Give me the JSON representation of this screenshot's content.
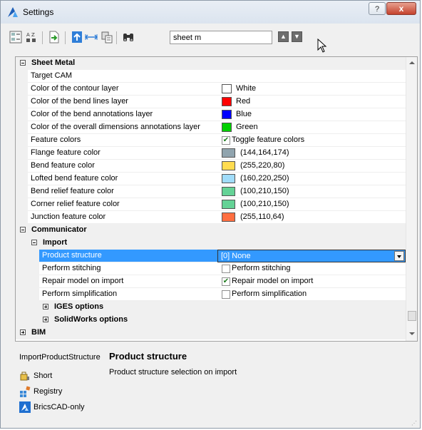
{
  "window": {
    "title": "Settings",
    "help_label": "?",
    "close_label": "x"
  },
  "toolbar": {
    "search_value": "sheet m",
    "search_placeholder": ""
  },
  "grid": {
    "sheet_metal": {
      "label": "Sheet Metal",
      "rows": [
        {
          "name": "Target CAM",
          "value": ""
        },
        {
          "name": "Color of the contour layer",
          "value": "White",
          "color": "#ffffff"
        },
        {
          "name": "Color of the bend lines layer",
          "value": "Red",
          "color": "#ff0000"
        },
        {
          "name": "Color of the bend annotations layer",
          "value": "Blue",
          "color": "#0000ff"
        },
        {
          "name": "Color of the overall dimensions annotations layer",
          "value": "Green",
          "color": "#00d000"
        },
        {
          "name": "Feature colors",
          "value": "Toggle feature colors",
          "checked": true
        },
        {
          "name": "Flange feature color",
          "value": "(144,164,174)",
          "color": "#90a4ae"
        },
        {
          "name": "Bend feature color",
          "value": "(255,220,80)",
          "color": "#ffdc50"
        },
        {
          "name": "Lofted bend feature color",
          "value": "(160,220,250)",
          "color": "#a0dcfa"
        },
        {
          "name": "Bend relief feature color",
          "value": "(100,210,150)",
          "color": "#64d296"
        },
        {
          "name": "Corner relief feature color",
          "value": "(100,210,150)",
          "color": "#64d296"
        },
        {
          "name": "Junction feature color",
          "value": "(255,110,64)",
          "color": "#ff6e40"
        }
      ]
    },
    "communicator": {
      "label": "Communicator",
      "import": {
        "label": "Import",
        "rows": [
          {
            "name": "Product structure",
            "value": "[0] None"
          },
          {
            "name": "Perform stitching",
            "value": "Perform stitching",
            "checked": false
          },
          {
            "name": "Repair model on import",
            "value": "Repair model on import",
            "checked": true
          },
          {
            "name": "Perform simplification",
            "value": "Perform simplification",
            "checked": false
          }
        ]
      },
      "iges": "IGES options",
      "solidworks": "SolidWorks options"
    },
    "bim": {
      "label": "BIM"
    }
  },
  "info": {
    "key": "ImportProductStructure",
    "title": "Product structure",
    "description": "Product structure selection on import",
    "legend": [
      {
        "label": "Short",
        "icon": "short-icon"
      },
      {
        "label": "Registry",
        "icon": "registry-icon"
      },
      {
        "label": "BricsCAD-only",
        "icon": "bricscad-icon"
      }
    ]
  },
  "colors": {
    "selection": "#3399ff",
    "close": "#c4422d",
    "checkmark": "#1c7a1c"
  }
}
